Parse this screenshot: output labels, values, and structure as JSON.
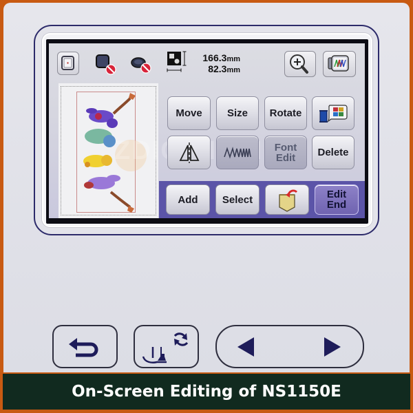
{
  "toolbar": {
    "dimensions": {
      "height": "166.3",
      "width": "82.3",
      "unit": "mm"
    },
    "icons": [
      "embroidery-frame-icon",
      "frame-hoop-disabled-icon",
      "oval-frame-disabled-icon",
      "pattern-size-icon",
      "zoom-in-icon",
      "stitch-preview-icon"
    ]
  },
  "edit_buttons": {
    "move": "Move",
    "size": "Size",
    "rotate": "Rotate",
    "thread_color_icon": "thread-color-palette-icon",
    "mirror_icon": "mirror-flip-icon",
    "density_icon": "stitch-density-icon",
    "font_edit_line1": "Font",
    "font_edit_line2": "Edit",
    "delete": "Delete"
  },
  "bottom_buttons": {
    "add": "Add",
    "select": "Select",
    "pocket_icon": "memory-pocket-icon",
    "edit_end_line1": "Edit",
    "edit_end_line2": "End"
  },
  "watermark": "ZDIGITIZING",
  "hardware_buttons": [
    "back-icon",
    "presser-foot-icon",
    "previous-icon",
    "next-icon"
  ],
  "caption": "On-Screen Editing of NS1150E",
  "colors": {
    "frame_border": "#c85a12",
    "caption_bg": "#112a1f",
    "bezel_outline": "#2c2a6a",
    "edit_end_bg": "#7a6ebc",
    "bottom_bar": "#5b54a8"
  }
}
